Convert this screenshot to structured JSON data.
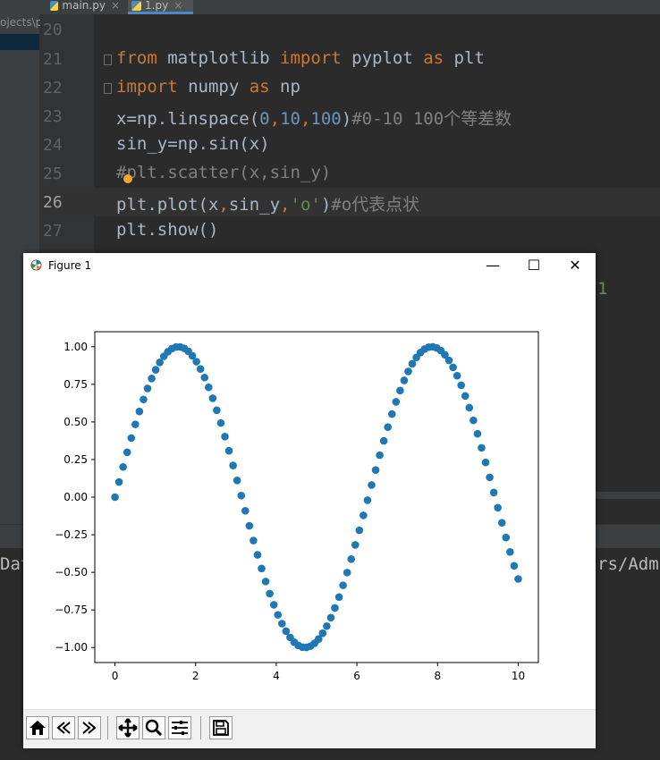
{
  "tabs": [
    {
      "label": "main.py",
      "close": "×",
      "active": false
    },
    {
      "label": "1.py",
      "close": "×",
      "active": true
    }
  ],
  "project_panel": {
    "path_text": "ojects\\p"
  },
  "editor": {
    "lines": [
      {
        "num": "20"
      },
      {
        "num": "21",
        "tokens": [
          "from",
          " matplotlib ",
          "import",
          " pyplot ",
          "as",
          " plt"
        ]
      },
      {
        "num": "22",
        "tokens": [
          "import",
          " numpy ",
          "as",
          " np"
        ]
      },
      {
        "num": "23",
        "tokens": [
          "x=np.linspace(",
          "0",
          ",",
          "10",
          ",",
          "100",
          ")",
          "#0-10 100个等差数"
        ]
      },
      {
        "num": "24",
        "tokens": [
          "sin_y=np.sin(x)"
        ]
      },
      {
        "num": "25",
        "tokens": [
          "#plt.scatter(x,sin_y)"
        ]
      },
      {
        "num": "26",
        "tokens": [
          "plt.plot(x",
          ",",
          "sin_y",
          ",",
          "'o'",
          ")",
          "#o代表点状"
        ]
      },
      {
        "num": "27",
        "tokens": [
          "plt.show()"
        ]
      }
    ],
    "side_fragment": "1"
  },
  "console": {
    "left_fragment": "Dat",
    "right_fragment": "rs/Adm"
  },
  "figure": {
    "title": "Figure 1",
    "controls": {
      "minimize": "—",
      "maximize": "☐",
      "close": "✕"
    },
    "toolbar": [
      "home-icon",
      "back-icon",
      "forward-icon",
      "pan-icon",
      "zoom-icon",
      "configure-subplots-icon",
      "save-icon"
    ]
  },
  "chart_data": {
    "type": "scatter",
    "title": "",
    "xlabel": "",
    "ylabel": "",
    "xlim": [
      -0.5,
      10.5
    ],
    "ylim": [
      -1.1,
      1.1
    ],
    "xticks": [
      0,
      2,
      4,
      6,
      8,
      10
    ],
    "xtick_labels": [
      "0",
      "2",
      "4",
      "6",
      "8",
      "10"
    ],
    "yticks": [
      -1.0,
      -0.75,
      -0.5,
      -0.25,
      0.0,
      0.25,
      0.5,
      0.75,
      1.0
    ],
    "ytick_labels": [
      "−1.00",
      "−0.75",
      "−0.50",
      "−0.25",
      "0.00",
      "0.25",
      "0.50",
      "0.75",
      "1.00"
    ],
    "grid": false,
    "marker_color": "#1f77b4",
    "series": [
      {
        "function": "sin",
        "x_start": 0,
        "x_end": 10,
        "n_points": 100
      }
    ]
  }
}
